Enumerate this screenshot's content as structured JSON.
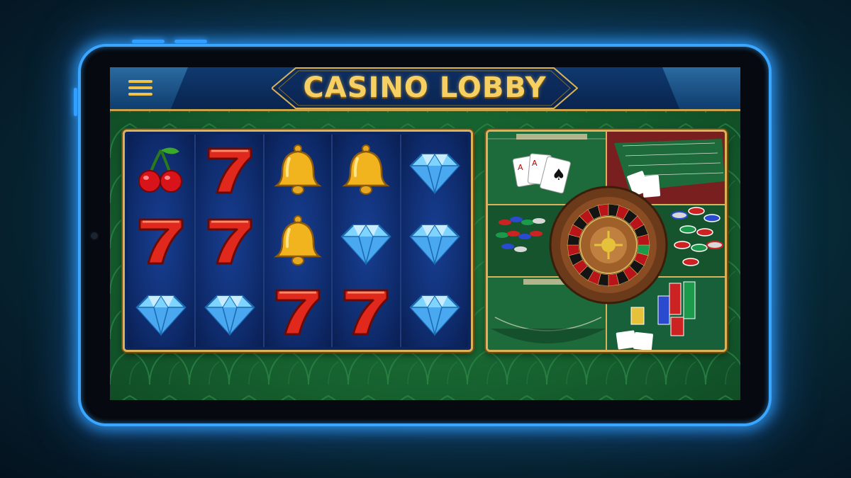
{
  "app": {
    "title": "CASINO LOBBY",
    "menu_icon": "hamburger-menu-icon"
  },
  "colors": {
    "gold": "#f7d063",
    "header_blue": "#0b2a57",
    "felt_green": "#1f7a3e",
    "glow_blue": "#3aa6ff",
    "seven_red": "#e0291c",
    "diamond_blue": "#7fd3ff"
  },
  "slot_machine": {
    "reels": [
      [
        "cherry",
        "seven",
        "diamond"
      ],
      [
        "seven",
        "seven",
        "diamond"
      ],
      [
        "bell",
        "bell",
        "seven"
      ],
      [
        "bell",
        "diamond",
        "seven"
      ],
      [
        "diamond",
        "diamond",
        "diamond"
      ]
    ]
  },
  "table_games": {
    "tiles": [
      "blackjack-table",
      "roulette-table",
      "casino-chips",
      "roulette-wheel",
      "blackjack-table",
      "casino-chips"
    ]
  }
}
